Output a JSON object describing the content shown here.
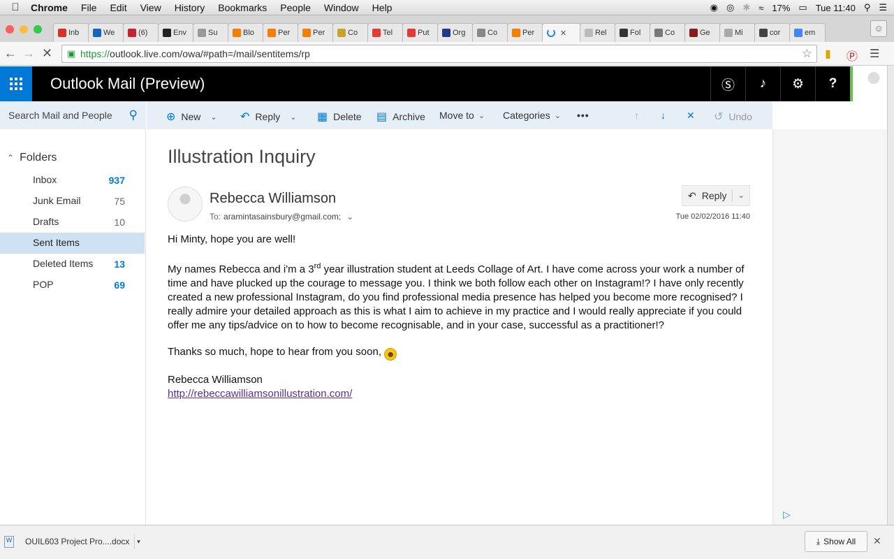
{
  "menubar": {
    "app": "Chrome",
    "items": [
      "File",
      "Edit",
      "View",
      "History",
      "Bookmarks",
      "People",
      "Window",
      "Help"
    ],
    "battery": "17%",
    "clock": "Tue 11:40"
  },
  "tabs": [
    {
      "label": "Inb",
      "color": "#d93025"
    },
    {
      "label": "We",
      "color": "#1565c0"
    },
    {
      "label": "(6)",
      "color": "#c8232c"
    },
    {
      "label": "Env",
      "color": "#222222"
    },
    {
      "label": "Su",
      "color": "#999999"
    },
    {
      "label": "Blo",
      "color": "#f57d00"
    },
    {
      "label": "Per",
      "color": "#f57d00"
    },
    {
      "label": "Per",
      "color": "#f57d00"
    },
    {
      "label": "Co",
      "color": "#c9a227"
    },
    {
      "label": "Tel",
      "color": "#e53935"
    },
    {
      "label": "Put",
      "color": "#e53935"
    },
    {
      "label": "Org",
      "color": "#1e3a8a"
    },
    {
      "label": "Co",
      "color": "#888888"
    },
    {
      "label": "Per",
      "color": "#f57d00"
    },
    {
      "label": "",
      "color": "#1e88e5",
      "active": true
    },
    {
      "label": "Rel",
      "color": "#bbbbbb"
    },
    {
      "label": "Fol",
      "color": "#333333"
    },
    {
      "label": "Co",
      "color": "#777777"
    },
    {
      "label": "Ge",
      "color": "#8b1a1a"
    },
    {
      "label": "Mi",
      "color": "#aaaaaa"
    },
    {
      "label": "cor",
      "color": "#444444"
    },
    {
      "label": "em",
      "color": "#4285f4"
    }
  ],
  "omnibox": {
    "scheme": "https://",
    "rest": "outlook.live.com/owa/#path=/mail/sentitems/rp"
  },
  "owa": {
    "title": "Outlook Mail (Preview)"
  },
  "search": {
    "placeholder": "Search Mail and People"
  },
  "folders": {
    "heading": "Folders",
    "items": [
      {
        "label": "Inbox",
        "count": "937",
        "style": "blue"
      },
      {
        "label": "Junk Email",
        "count": "75",
        "style": "grey"
      },
      {
        "label": "Drafts",
        "count": "10",
        "style": "grey"
      },
      {
        "label": "Sent Items",
        "count": "",
        "style": "sel"
      },
      {
        "label": "Deleted Items",
        "count": "13",
        "style": "blue"
      },
      {
        "label": "POP",
        "count": "69",
        "style": "blue"
      }
    ]
  },
  "commands": {
    "new": "New",
    "reply": "Reply",
    "delete": "Delete",
    "archive": "Archive",
    "move_to": "Move to",
    "categories": "Categories",
    "more": "•••",
    "undo": "Undo"
  },
  "message": {
    "subject": "Illustration Inquiry",
    "sender": "Rebecca Williamson",
    "to_label": "To:",
    "to": "aramintasainsbury@gmail.com;",
    "date": "Tue 02/02/2016 11:40",
    "reply_label": "Reply",
    "greeting": "Hi Minty, hope you are well!",
    "para1_a": "My names Rebecca and i'm a 3",
    "para1_sup": "rd",
    "para1_b": " year illustration student at Leeds Collage of Art. I have come across your work a number of time and have plucked up the courage to message you. I think we both follow each other on Instagram!? I have only recently created a new professional Instagram, do you find professional media presence has helped you become more recognised?  I really admire your detailed approach as this is what I aim to achieve in my practice and I would really appreciate if you could offer me any tips/advice on to how to become recognisable, and in your case, successful as a practitioner!?",
    "thanks": "Thanks so much, hope to hear from you soon, ",
    "signature": "Rebecca Williamson",
    "link": "http://rebeccawilliamsonillustration.com/"
  },
  "download": {
    "filename": "OUIL603 Project Pro....docx",
    "show_all": "Show All"
  }
}
